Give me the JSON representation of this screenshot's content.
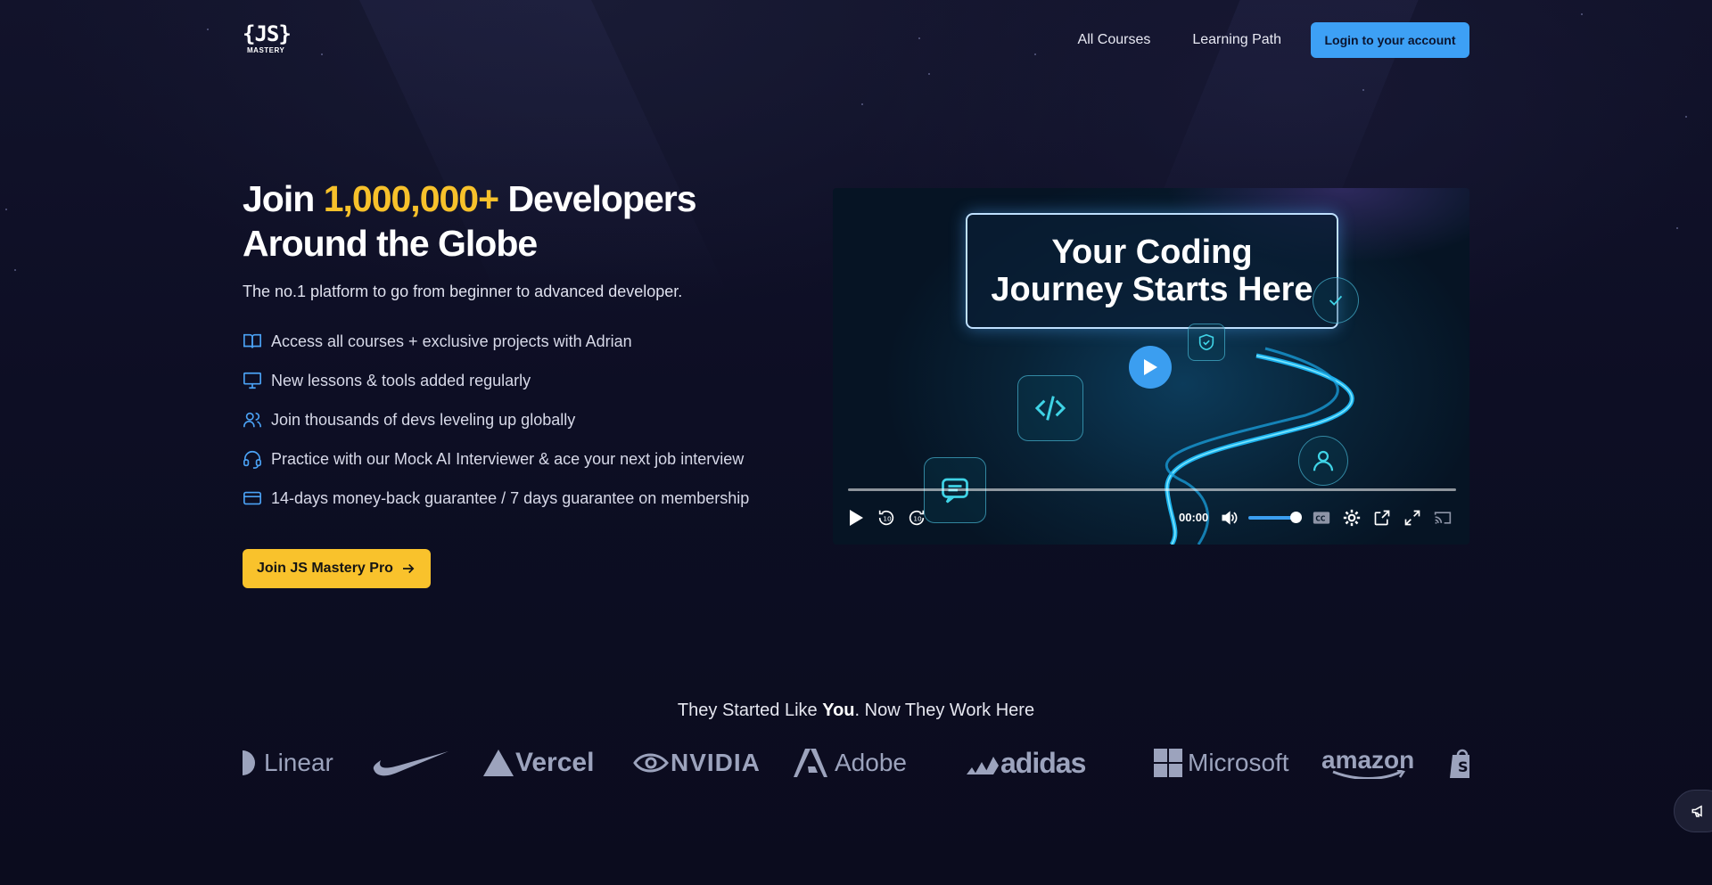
{
  "header": {
    "logo_mark": "{JS}",
    "logo_word": "MASTERY",
    "nav": {
      "all_courses": "All Courses",
      "learning_path": "Learning Path",
      "login": "Login to your account"
    }
  },
  "hero": {
    "title_prefix": "Join",
    "title_accent": "1,000,000+",
    "title_line1_suffix": "Developers",
    "title_line2": "Around the Globe",
    "subtitle": "The no.1 platform to go from beginner to advanced developer.",
    "features": [
      {
        "icon": "book-open-icon",
        "text": "Access all courses + exclusive projects with Adrian"
      },
      {
        "icon": "monitor-icon",
        "text": "New lessons & tools added regularly"
      },
      {
        "icon": "users-icon",
        "text": "Join thousands of devs leveling up globally"
      },
      {
        "icon": "headset-icon",
        "text": "Practice with our Mock AI Interviewer & ace your next job interview"
      },
      {
        "icon": "credit-card-icon",
        "text": "14-days money-back guarantee / 7 days guarantee on membership"
      }
    ],
    "cta": "Join JS Mastery Pro"
  },
  "video": {
    "title_line1": "Your Coding",
    "title_line2": "Journey Starts Here",
    "time": "00:00",
    "progress": 0,
    "volume": 0.85,
    "controls": [
      "play-icon",
      "rewind-10-icon",
      "forward-10-icon",
      "volume-icon",
      "captions-icon",
      "settings-icon",
      "open-external-icon",
      "fullscreen-icon",
      "cast-icon"
    ]
  },
  "logos_band": {
    "title_before": "They Started Like",
    "title_bold": "You",
    "title_after": ". Now They Work Here",
    "brands": [
      "Linear",
      "Nike",
      "Vercel",
      "NVIDIA",
      "Adobe",
      "adidas",
      "Microsoft",
      "amazon",
      "Shopify"
    ]
  },
  "colors": {
    "background": "#0b0c1e",
    "accent_yellow": "#f7c12b",
    "accent_blue": "#3da0f5",
    "cta_yellow": "#f9c22c"
  }
}
